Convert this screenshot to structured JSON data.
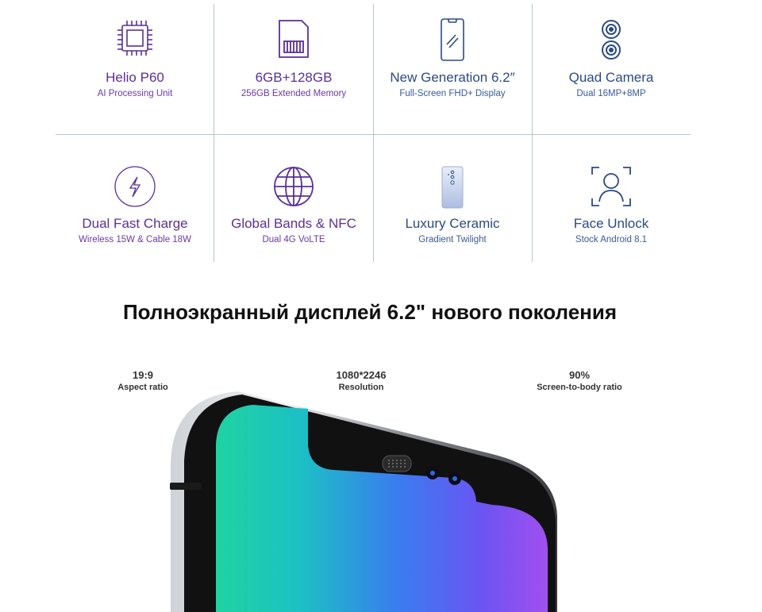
{
  "features": [
    {
      "title": "Helio P60",
      "subtitle": "AI Processing Unit",
      "icon": "chip-icon",
      "color": "purple"
    },
    {
      "title": "6GB+128GB",
      "subtitle": "256GB Extended Memory",
      "icon": "sd-card-icon",
      "color": "purple"
    },
    {
      "title": "New Generation 6.2″",
      "subtitle": "Full-Screen FHD+ Display",
      "icon": "phone-screen-icon",
      "color": "blue"
    },
    {
      "title": "Quad Camera",
      "subtitle": "Dual 16MP+8MP",
      "icon": "dual-camera-icon",
      "color": "blue"
    },
    {
      "title": "Dual Fast Charge",
      "subtitle": "Wireless 15W & Cable 18W",
      "icon": "lightning-charge-icon",
      "color": "purple"
    },
    {
      "title": "Global Bands & NFC",
      "subtitle": "Dual 4G VoLTE",
      "icon": "globe-icon",
      "color": "purple"
    },
    {
      "title": "Luxury Ceramic",
      "subtitle": "Gradient Twilight",
      "icon": "phone-back-icon",
      "color": "blue"
    },
    {
      "title": "Face Unlock",
      "subtitle": "Stock Android 8.1",
      "icon": "face-scan-icon",
      "color": "blue"
    }
  ],
  "heading": "Полноэкранный дисплей 6.2\" нового поколения",
  "specs": [
    {
      "value": "19:9",
      "label": "Aspect ratio"
    },
    {
      "value": "1080*2246",
      "label": "Resolution"
    },
    {
      "value": "90%",
      "label": "Screen-to-body ratio"
    }
  ]
}
